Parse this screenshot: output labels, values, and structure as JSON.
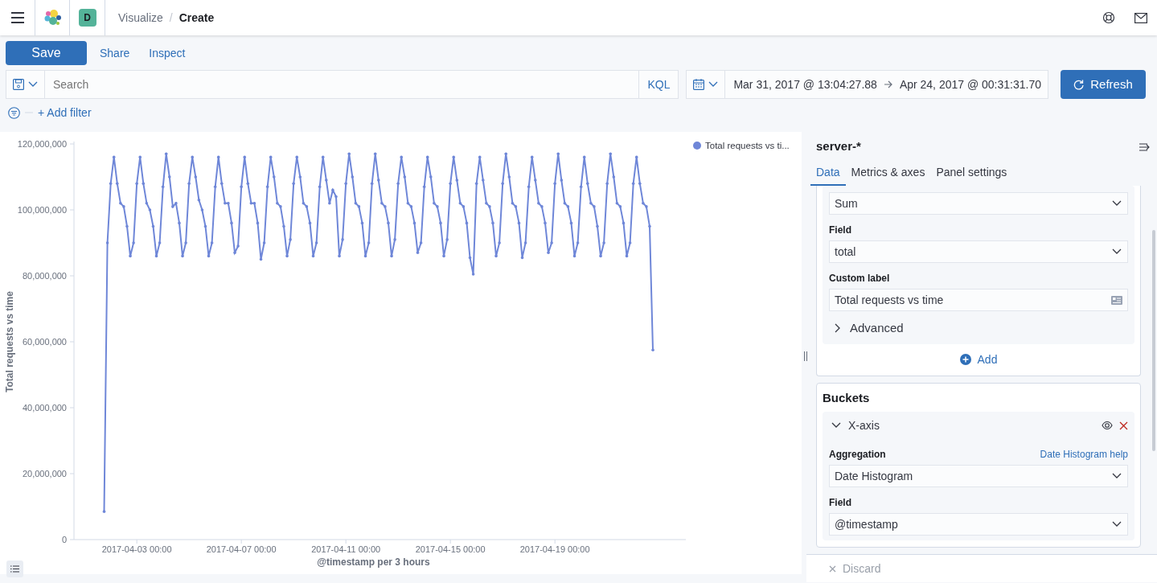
{
  "header": {
    "space_initial": "D",
    "separator": "/",
    "breadcrumbs": [
      {
        "label": "Visualize",
        "current": false
      },
      {
        "label": "Create",
        "current": true
      }
    ]
  },
  "top_nav": [
    {
      "label": "Save",
      "kind": "primary"
    },
    {
      "label": "Share",
      "kind": "link"
    },
    {
      "label": "Inspect",
      "kind": "link"
    }
  ],
  "query_bar": {
    "placeholder": "Search",
    "language": "KQL",
    "start": "Mar 31, 2017 @ 13:04:27.88",
    "end": "Apr 24, 2017 @ 00:31:31.70",
    "refresh": "Refresh"
  },
  "filter_bar": {
    "add_filter": "+ Add filter"
  },
  "chart": {
    "chart_data": {
      "type": "line",
      "xlabel": "@timestamp per 3 hours",
      "ylabel": "Total requests vs time",
      "ylim": [
        0,
        120000000
      ],
      "categories": [
        null,
        null,
        null,
        null,
        null,
        null,
        null,
        null,
        null,
        null,
        "2017-04-03 00:00",
        null,
        null,
        null,
        null,
        null,
        null,
        null,
        null,
        null,
        null,
        null,
        null,
        null,
        null,
        null,
        null,
        null,
        null,
        null,
        null,
        null,
        null,
        null,
        null,
        null,
        null,
        null,
        null,
        null,
        null,
        null,
        "2017-04-07 00:00",
        null,
        null,
        null,
        null,
        null,
        null,
        null,
        null,
        null,
        null,
        null,
        null,
        null,
        null,
        null,
        null,
        null,
        null,
        null,
        null,
        null,
        null,
        null,
        null,
        null,
        null,
        null,
        null,
        null,
        null,
        null,
        "2017-04-11 00:00",
        null,
        null,
        null,
        null,
        null,
        null,
        null,
        null,
        null,
        null,
        null,
        null,
        null,
        null,
        null,
        null,
        null,
        null,
        null,
        null,
        null,
        null,
        null,
        null,
        null,
        null,
        null,
        null,
        null,
        null,
        null,
        "2017-04-15 00:00",
        null,
        null,
        null,
        null,
        null,
        null,
        null,
        null,
        null,
        null,
        null,
        null,
        null,
        null,
        null,
        null,
        null,
        null,
        null,
        null,
        null,
        null,
        null,
        null,
        null,
        null,
        null,
        null,
        null,
        null,
        null,
        "2017-04-19 00:00",
        null,
        null,
        null,
        null,
        null,
        null,
        null,
        null,
        null,
        null,
        null,
        null,
        null,
        null,
        null,
        null,
        null,
        null,
        null,
        null,
        null,
        null,
        null,
        null,
        null,
        null,
        null,
        null,
        null,
        null
      ],
      "yticks": [
        {
          "value": 0,
          "label": "0"
        },
        {
          "value": 20000000,
          "label": "20,000,000"
        },
        {
          "value": 40000000,
          "label": "40,000,000"
        },
        {
          "value": 60000000,
          "label": "60,000,000"
        },
        {
          "value": 80000000,
          "label": "80,000,000"
        },
        {
          "value": 100000000,
          "label": "100,000,000"
        },
        {
          "value": 120000000,
          "label": "120,000,000"
        }
      ],
      "series": [
        {
          "name": "Total requests vs ti...",
          "color": "#6f87d8",
          "values": [
            8500000,
            90000000,
            108000000,
            116000000,
            108000000,
            102000000,
            101000000,
            95000000,
            86000000,
            90000000,
            108000000,
            116000000,
            108000000,
            102000000,
            100000000,
            95000000,
            86000000,
            90000000,
            107000000,
            117000000,
            110000000,
            101000000,
            102000000,
            96000000,
            86000000,
            90000000,
            108000000,
            116000000,
            110000000,
            103000000,
            100000000,
            95000000,
            86000000,
            90000000,
            107000000,
            116000000,
            108000000,
            102000000,
            102000000,
            96000000,
            87000000,
            89000000,
            107000000,
            116000000,
            108000000,
            102000000,
            102000000,
            96000000,
            85000000,
            90000000,
            107000000,
            116000000,
            110000000,
            102000000,
            101000000,
            95000000,
            86000000,
            91000000,
            108000000,
            116000000,
            110000000,
            102000000,
            101000000,
            96000000,
            86000000,
            90000000,
            107000000,
            116000000,
            109000000,
            102000000,
            106000000,
            104000000,
            86000000,
            91000000,
            108000000,
            117000000,
            110000000,
            102000000,
            101000000,
            96000000,
            86000000,
            90000000,
            108000000,
            117000000,
            109000000,
            102000000,
            101000000,
            96000000,
            86000000,
            91000000,
            108000000,
            116000000,
            110000000,
            102000000,
            101000000,
            96000000,
            87000000,
            90000000,
            107000000,
            116000000,
            110000000,
            102000000,
            101000000,
            96000000,
            86000000,
            91000000,
            108000000,
            116000000,
            109000000,
            102000000,
            101000000,
            96000000,
            85500000,
            80500000,
            108000000,
            116000000,
            109000000,
            102000000,
            101000000,
            96000000,
            86000000,
            90000000,
            108000000,
            117000000,
            110000000,
            102000000,
            101000000,
            96000000,
            85500000,
            90000000,
            107000000,
            116000000,
            109000000,
            102000000,
            101000000,
            96000000,
            87000000,
            90000000,
            108000000,
            117000000,
            109000000,
            102000000,
            101000000,
            96000000,
            86000000,
            90000000,
            107000000,
            116000000,
            108000000,
            102000000,
            101000000,
            95000000,
            86000000,
            90000000,
            108000000,
            117000000,
            110000000,
            102000000,
            101000000,
            96000000,
            86000000,
            90000000,
            108000000,
            116000000,
            108000000,
            102000000,
            101000000,
            95000000,
            57500000
          ]
        }
      ]
    }
  },
  "panel": {
    "title": "server-*",
    "tabs": [
      {
        "label": "Data",
        "selected": true
      },
      {
        "label": "Metrics & axes",
        "selected": false
      },
      {
        "label": "Panel settings",
        "selected": false
      }
    ],
    "metric": {
      "fields": [
        {
          "kind": "select",
          "value": "Sum"
        },
        {
          "kind": "select",
          "label": "Field",
          "value": "total"
        },
        {
          "kind": "text",
          "label": "Custom label",
          "value": "Total requests vs time"
        }
      ],
      "advanced": {
        "label": "Advanced",
        "expanded": false
      },
      "add": "Add"
    },
    "buckets": {
      "title": "Buckets",
      "items": [
        {
          "label": "X-axis",
          "expanded": true,
          "fields": [
            {
              "kind": "select",
              "label": "Aggregation",
              "help": "Date Histogram help",
              "value": "Date Histogram"
            },
            {
              "kind": "select",
              "label": "Field",
              "value": "@timestamp"
            }
          ]
        }
      ]
    },
    "discard": "Discard"
  }
}
